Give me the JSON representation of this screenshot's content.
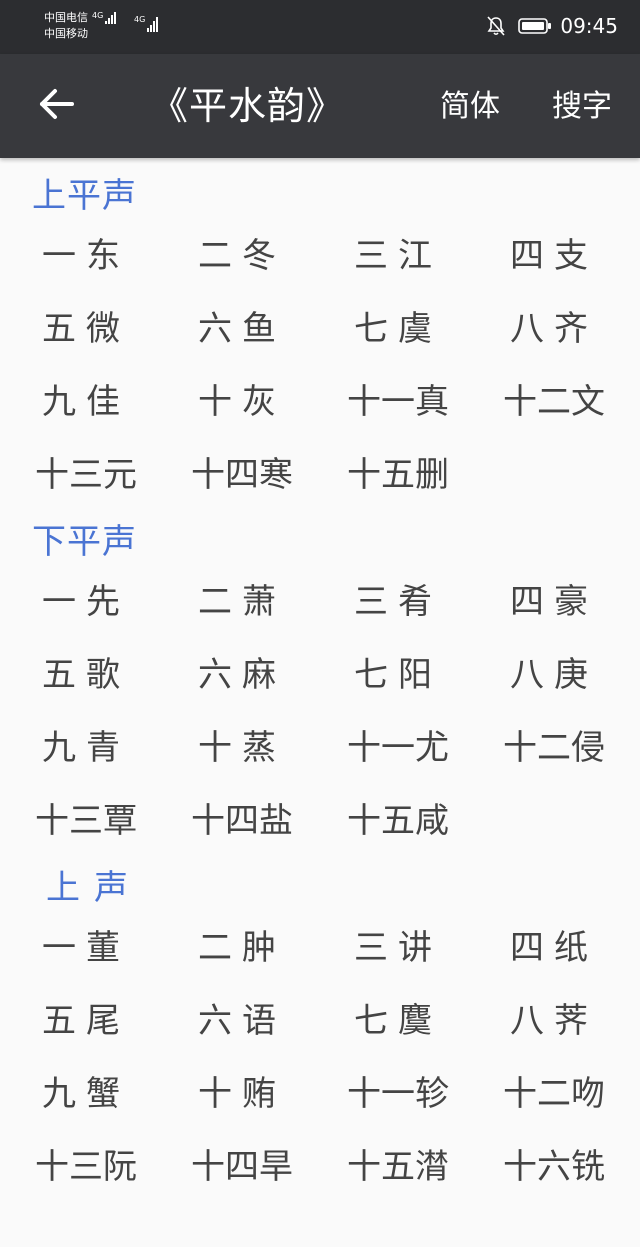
{
  "status_bar": {
    "carrier1": "中国电信",
    "carrier2": "中国移动",
    "network1": "4G",
    "network2": "4G",
    "time": "09:45"
  },
  "app_bar": {
    "title": "《平水韵》",
    "simplified_label": "简体",
    "search_label": "搜字"
  },
  "sections": [
    {
      "title": "上平声",
      "items": [
        "一东",
        "二冬",
        "三江",
        "四支",
        "五微",
        "六鱼",
        "七虞",
        "八齐",
        "九佳",
        "十灰",
        "十一真",
        "十二文",
        "十三元",
        "十四寒",
        "十五删"
      ]
    },
    {
      "title": "下平声",
      "items": [
        "一先",
        "二萧",
        "三肴",
        "四豪",
        "五歌",
        "六麻",
        "七阳",
        "八庚",
        "九青",
        "十蒸",
        "十一尤",
        "十二侵",
        "十三覃",
        "十四盐",
        "十五咸"
      ]
    },
    {
      "title": "上声",
      "items": [
        "一董",
        "二肿",
        "三讲",
        "四纸",
        "五尾",
        "六语",
        "七麌",
        "八荠",
        "九蟹",
        "十贿",
        "十一轸",
        "十二吻",
        "十三阮",
        "十四旱",
        "十五潸",
        "十六铣"
      ]
    }
  ]
}
